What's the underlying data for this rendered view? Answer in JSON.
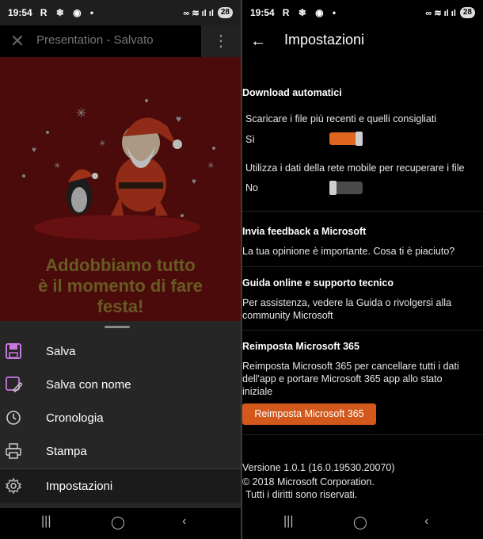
{
  "status_bar": {
    "time": "19:54",
    "notification_icons": "R ❄ ◉ •",
    "system_icons": "∞ ≋ ıl ıl",
    "battery": "28"
  },
  "left": {
    "title": "Presentation - Salvato",
    "slide_text": [
      "Addobbiamo tutto",
      "è il momento di fare",
      "festa!"
    ],
    "menu": [
      {
        "label": "Salva",
        "icon": "save-icon"
      },
      {
        "label": "Salva con nome",
        "icon": "save-as-icon"
      },
      {
        "label": "Cronologia",
        "icon": "history-icon"
      },
      {
        "label": "Stampa",
        "icon": "print-icon"
      },
      {
        "label": "Impostazioni",
        "icon": "gear-icon"
      }
    ]
  },
  "right": {
    "title": "Impostazioni",
    "download": {
      "heading": "Download automatici",
      "setting1_label": "Scaricare i file più recenti e quelli consigliati",
      "setting1_value": "Sì",
      "setting2_label": "Utilizza i dati della rete mobile per recuperare i file",
      "setting2_value": "No"
    },
    "feedback": {
      "heading": "Invia feedback a Microsoft",
      "text": "La tua opinione è importante. Cosa ti è piaciuto?"
    },
    "guide": {
      "heading": "Guida online e supporto tecnico",
      "text1": "Per assistenza, vedere la Guida o rivolgersi alla",
      "text2": "community Microsoft"
    },
    "reset": {
      "heading": "Reimposta Microsoft 365",
      "text1": "Reimposta Microsoft 365 per cancellare tutti i dati",
      "text2": "dell'app e portare Microsoft 365 app allo stato",
      "text3": "iniziale",
      "button": "Reimposta Microsoft 365"
    },
    "footer": {
      "version": "Versione 1.0.1 (16.0.19530.20070)",
      "copyright": "© 2018 Microsoft Corporation.",
      "rights": "Tutti i diritti sono riservati."
    }
  },
  "colors": {
    "accent": "#d2581c",
    "slide_bg": "#5a0d0e",
    "panel_bg": "#262626"
  }
}
